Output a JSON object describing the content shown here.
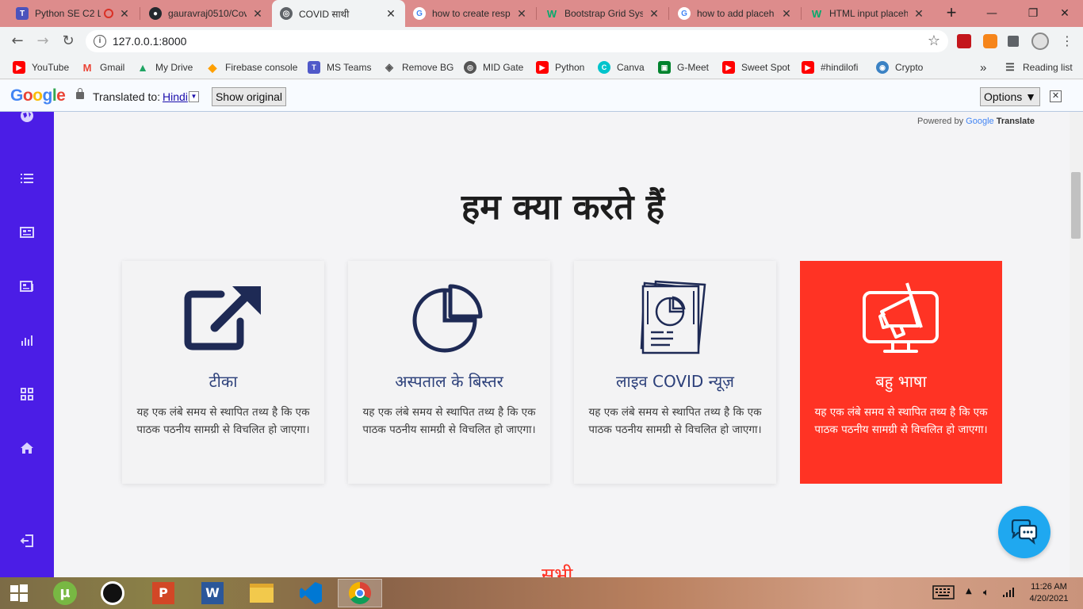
{
  "browser": {
    "tabs": [
      {
        "title": "Python SE C2 L",
        "fav": "T",
        "color": "#4b53bc"
      },
      {
        "title": "gauravraj0510/Cov",
        "fav": "G",
        "color": "#24292e"
      },
      {
        "title": "COVID साथी",
        "fav": "◎",
        "color": "#5f6368"
      },
      {
        "title": "how to create resp",
        "fav": "G",
        "color": "#ffffff"
      },
      {
        "title": "Bootstrap Grid Syst",
        "fav": "W",
        "color": "#04aa6d"
      },
      {
        "title": "how to add placeh",
        "fav": "G",
        "color": "#ffffff"
      },
      {
        "title": "HTML input placeh",
        "fav": "W",
        "color": "#04aa6d"
      }
    ],
    "url": "127.0.0.1:8000",
    "bookmarks": [
      {
        "label": "YouTube",
        "color": "#ff0000"
      },
      {
        "label": "Gmail",
        "color": "#ea4335"
      },
      {
        "label": "My Drive",
        "color": "#1fa463"
      },
      {
        "label": "Firebase console",
        "color": "#ffca28"
      },
      {
        "label": "MS Teams",
        "color": "#5059c9"
      },
      {
        "label": "Remove BG",
        "color": "#555555"
      },
      {
        "label": "MID Gate",
        "color": "#555555"
      },
      {
        "label": "Python",
        "color": "#ff0000"
      },
      {
        "label": "Canva",
        "color": "#00c4cc"
      },
      {
        "label": "G-Meet",
        "color": "#00832d"
      },
      {
        "label": "Sweet Spot",
        "color": "#ff0000"
      },
      {
        "label": "#hindilofi",
        "color": "#ff0000"
      },
      {
        "label": "Crypto",
        "color": "#3b82c4"
      }
    ],
    "bookmarks_more": "»",
    "reading_list": "Reading list"
  },
  "translate_bar": {
    "logo": "Google",
    "translated_to": "Translated to:",
    "language": "Hindi",
    "show_original": "Show original",
    "options": "Options ▼",
    "close": "✕",
    "powered_by": "Powered by",
    "powered_google": "Google",
    "powered_translate": "Translate"
  },
  "page": {
    "heading": "हम क्या करते हैं",
    "cards": [
      {
        "title": "टीका",
        "desc": "यह एक लंबे समय से स्थापित तथ्य है कि एक पाठक पठनीय सामग्री से विचलित हो जाएगा।",
        "icon": "external-link-icon",
        "highlight": false
      },
      {
        "title": "अस्पताल के बिस्तर",
        "desc": "यह एक लंबे समय से स्थापित तथ्य है कि एक पाठक पठनीय सामग्री से विचलित हो जाएगा।",
        "icon": "pie-chart-icon",
        "highlight": false
      },
      {
        "title": "लाइव COVID न्यूज़",
        "desc": "यह एक लंबे समय से स्थापित तथ्य है कि एक पाठक पठनीय सामग्री से विचलित हो जाएगा।",
        "icon": "news-report-icon",
        "highlight": false
      },
      {
        "title": "बहु भाषा",
        "desc": "यह एक लंबे समय से स्थापित तथ्य है कि एक पाठक पठनीय सामग्री से विचलित हो जाएगा।",
        "icon": "megaphone-monitor-icon",
        "highlight": true
      }
    ],
    "next_section_partial": "सभी",
    "accent": "#ff3324",
    "sidebar_color": "#4b1de6"
  },
  "taskbar": {
    "time": "11:26 AM",
    "date": "4/20/2021"
  }
}
